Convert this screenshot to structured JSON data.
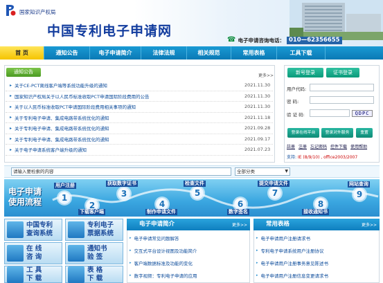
{
  "header": {
    "agency": "国家知识产权局",
    "site_title": "中国专利电子申请网",
    "hotline_label": "电子申请咨询电话：",
    "hotline_number": "010—62356655"
  },
  "nav": [
    {
      "label": "首 页",
      "active": true
    },
    {
      "label": "通知公告"
    },
    {
      "label": "电子申请简介"
    },
    {
      "label": "法律法规"
    },
    {
      "label": "相关规范"
    },
    {
      "label": "常用表格"
    },
    {
      "label": "工具下载"
    }
  ],
  "notices": {
    "tab_label": "通知公告",
    "more_label": "更多>>",
    "items": [
      {
        "title": "关于CE-PCT离线客户端等系统功能升级的通知",
        "date": "2021.11.30"
      },
      {
        "title": "国家知识产权局关于以人民币标准收取PCT申请国际阶段费用的公告",
        "date": "2021.11.30"
      },
      {
        "title": "关于以人民币标准收取PCT申请国际阶段费用相关事项的通知",
        "date": "2021.11.30"
      },
      {
        "title": "关于专利电子申请、集成电路带系统优化的通知",
        "date": "2021.11.18"
      },
      {
        "title": "关于专利电子申请、集成电路带系统优化的通知",
        "date": "2021.09.28"
      },
      {
        "title": "关于专利电子申请、集成电路带系统优化的通知",
        "date": "2021.09.17"
      },
      {
        "title": "关于电子申请系统客户端升级的通知",
        "date": "2021.07.23"
      }
    ]
  },
  "login": {
    "tab_login": "新号登录",
    "tab_cert": "证书登录",
    "user_label": "用户代码:",
    "password_label": "密    码:",
    "captcha_label": "验 证 码:",
    "captcha_text": "QDPC",
    "btn_system": "登录在线平台",
    "btn_external": "登录对外服务",
    "btn_reset": "重置",
    "links": [
      "註册",
      "注册",
      "忘记密码",
      "控件下载",
      "使用帮助"
    ],
    "support_label": "支持:",
    "support_value": "IE (8/9/10) , office2003/2007"
  },
  "search": {
    "placeholder": "请输入要检索的内容",
    "category": "全部分类"
  },
  "flow": {
    "title_line1": "电子申请",
    "title_line2": "使用流程",
    "steps": [
      {
        "num": "1",
        "label": "用户注册"
      },
      {
        "num": "2",
        "label": "下载客户端"
      },
      {
        "num": "3",
        "label": "获取数字证书"
      },
      {
        "num": "4",
        "label": "制作申请文件"
      },
      {
        "num": "5",
        "label": "检查文件"
      },
      {
        "num": "6",
        "label": "数字签名"
      },
      {
        "num": "7",
        "label": "提交申请文件"
      },
      {
        "num": "8",
        "label": "接收通知书"
      },
      {
        "num": "9",
        "label": "网站查询"
      }
    ]
  },
  "quick_links": [
    {
      "line1": "中国专利",
      "line2": "查询系统"
    },
    {
      "line1": "专利电子",
      "line2": "票据系统"
    },
    {
      "line1": "在 线",
      "line2": "咨 询"
    },
    {
      "line1": "通知书",
      "line2": "验 签"
    },
    {
      "line1": "工 具",
      "line2": "下 载"
    },
    {
      "line1": "表 格",
      "line2": "下 载"
    }
  ],
  "intro_panel": {
    "title": "电子申请简介",
    "more": "更多>>",
    "items": [
      "电子申请常见问题解答",
      "交互式平台设计视图及功能简介",
      "客户端数据标准及功能的变化",
      "数字视频：专利电子申请的应用"
    ]
  },
  "forms_panel": {
    "title": "常用表格",
    "more": "更多>>",
    "items": [
      "电子申请用户注册请求书",
      "专利电子申请系统用户注册协议",
      "电子申请用户注册事务意见陈述书",
      "电子申请用户注册信息变更请求书"
    ]
  },
  "colors": {
    "nav": "#0f86c4",
    "accent_yellow": "#f5c400",
    "title_blue": "#123c9e",
    "green": "#4b9b22"
  }
}
